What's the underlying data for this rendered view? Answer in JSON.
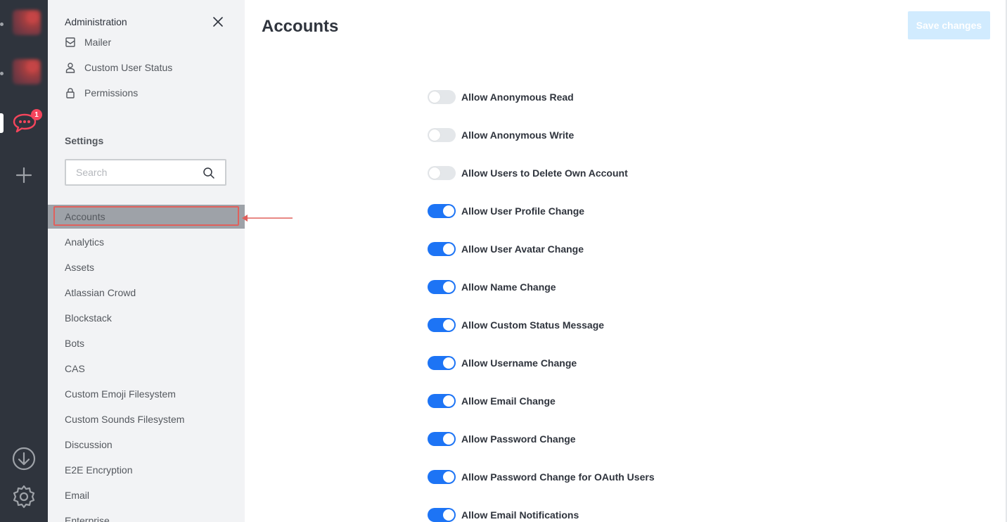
{
  "rail": {
    "badge_count": "1",
    "icons": [
      "server-1",
      "server-2",
      "rocket-chat-icon",
      "plus-icon",
      "download-icon",
      "gear-icon"
    ]
  },
  "sidebar": {
    "title": "Administration",
    "nav_items": [
      {
        "label": "Mailer",
        "icon": "mail-icon"
      },
      {
        "label": "Custom User Status",
        "icon": "user-icon"
      },
      {
        "label": "Permissions",
        "icon": "lock-icon"
      }
    ],
    "settings_heading": "Settings",
    "search_placeholder": "Search",
    "categories": [
      "Accounts",
      "Analytics",
      "Assets",
      "Atlassian Crowd",
      "Blockstack",
      "Bots",
      "CAS",
      "Custom Emoji Filesystem",
      "Custom Sounds Filesystem",
      "Discussion",
      "E2E Encryption",
      "Email",
      "Enterprise"
    ],
    "active_category": "Accounts"
  },
  "main": {
    "title": "Accounts",
    "save_label": "Save changes",
    "settings": [
      {
        "label": "Allow Anonymous Read",
        "enabled": false
      },
      {
        "label": "Allow Anonymous Write",
        "enabled": false
      },
      {
        "label": "Allow Users to Delete Own Account",
        "enabled": false
      },
      {
        "label": "Allow User Profile Change",
        "enabled": true
      },
      {
        "label": "Allow User Avatar Change",
        "enabled": true
      },
      {
        "label": "Allow Name Change",
        "enabled": true
      },
      {
        "label": "Allow Custom Status Message",
        "enabled": true
      },
      {
        "label": "Allow Username Change",
        "enabled": true
      },
      {
        "label": "Allow Email Change",
        "enabled": true
      },
      {
        "label": "Allow Password Change",
        "enabled": true
      },
      {
        "label": "Allow Password Change for OAuth Users",
        "enabled": true
      },
      {
        "label": "Allow Email Notifications",
        "enabled": true
      }
    ]
  },
  "colors": {
    "accent": "#1d74f5",
    "rail_bg": "#2f343d",
    "sidebar_bg": "#f2f3f5",
    "highlight": "#e0605c",
    "badge": "#f5455c"
  }
}
